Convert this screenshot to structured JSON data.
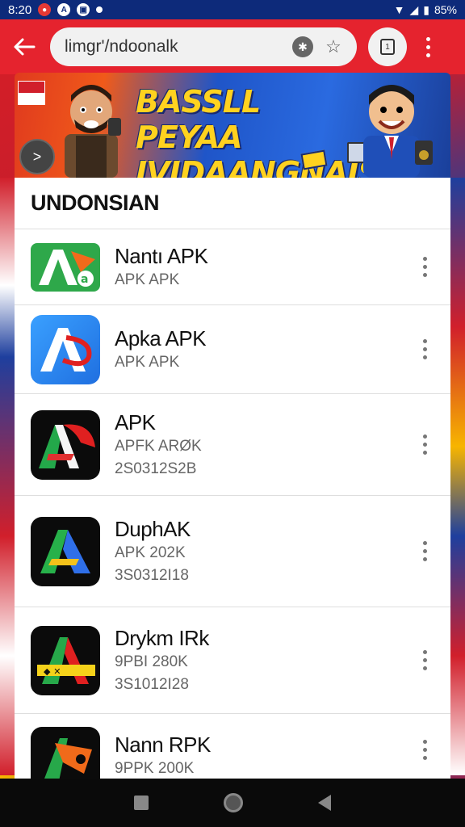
{
  "status_bar": {
    "time": "8:20",
    "battery": "85%"
  },
  "browser": {
    "url": "limgr'/ndoonalk",
    "menu_icon": "more-vert-icon"
  },
  "banner": {
    "title_line1": "BASSLL PEYAA",
    "title_line2": "IVIDAANGNAIS"
  },
  "section": {
    "title": "UNDONSIAN"
  },
  "apps": [
    {
      "name": "Nantı APK",
      "line1": "APK  APK",
      "line2": ""
    },
    {
      "name": "Apka APK",
      "line1": "APK  APK",
      "line2": ""
    },
    {
      "name": "APK",
      "line1": "APFK ARØK",
      "line2": "2S0312S2B"
    },
    {
      "name": "DuphAK",
      "line1": "APK 202K",
      "line2": "3S0312I18"
    },
    {
      "name": "Drykm IRk",
      "line1": "9PBI 280K",
      "line2": "3S1012I28"
    },
    {
      "name": "Nann RPK",
      "line1": "9PPK 200K",
      "line2": ""
    }
  ],
  "colors": {
    "toolbar": "#e5232e",
    "status_bar": "#0d2a7a",
    "banner_text": "#ffd21f"
  }
}
